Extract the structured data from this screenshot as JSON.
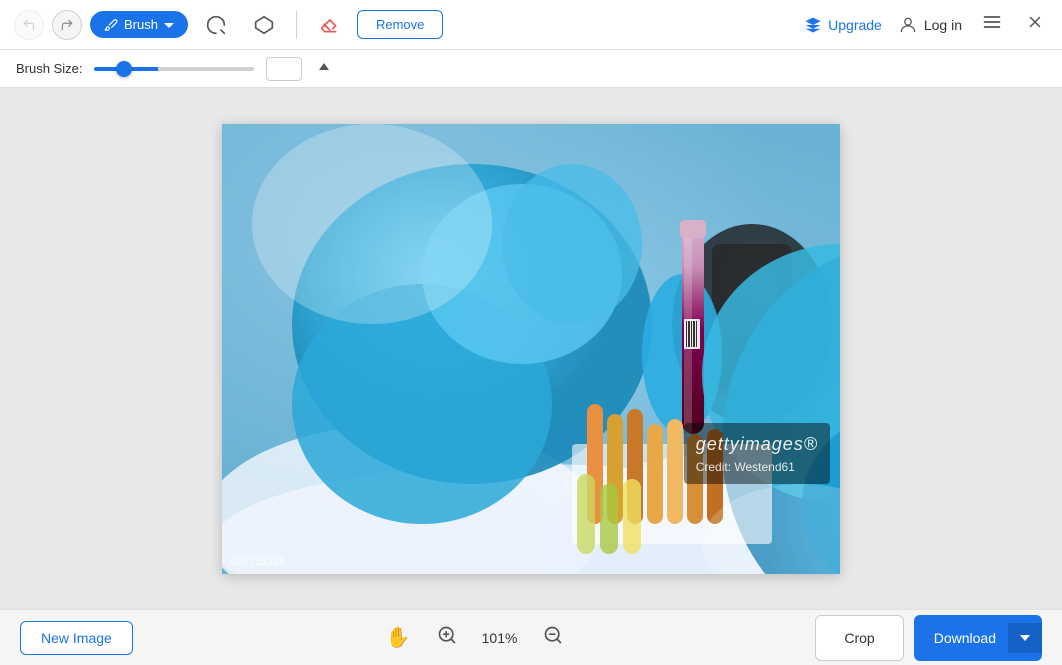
{
  "header": {
    "undo_label": "↩",
    "redo_label": "↪",
    "brush_label": "Brush",
    "lasso_label": "⬟",
    "polygon_label": "✦",
    "eraser_label": "⬜",
    "remove_label": "Remove",
    "upgrade_label": "Upgrade",
    "login_label": "Log in",
    "menu_label": "☰",
    "close_label": "✕"
  },
  "brush_bar": {
    "label": "Brush Size:",
    "value": 16,
    "min": 1,
    "max": 100,
    "percent": 16
  },
  "image": {
    "watermark_brand": "gettyimages®",
    "watermark_credit": "Credit: Westend61",
    "image_id": "926715326"
  },
  "zoom": {
    "pan_icon": "✋",
    "zoom_in_icon": "⊕",
    "level": "101%",
    "zoom_out_icon": "⊖"
  },
  "footer": {
    "new_image_label": "New Image",
    "crop_label": "Crop",
    "download_label": "Download",
    "download_arrow": "▲"
  }
}
